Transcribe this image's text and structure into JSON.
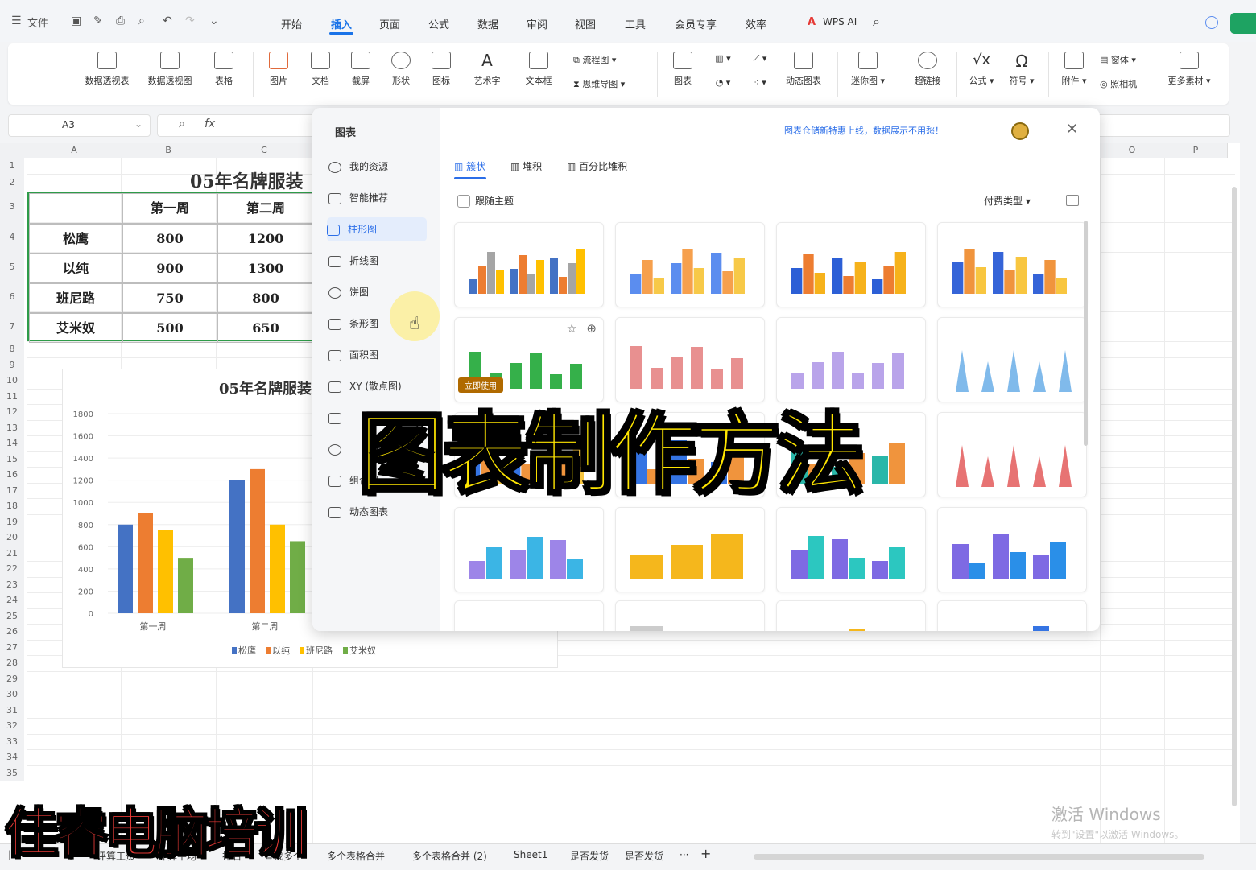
{
  "toolbar": {
    "file_label": "文件",
    "tabs": [
      "开始",
      "插入",
      "页面",
      "公式",
      "数据",
      "审阅",
      "视图",
      "工具",
      "会员专享",
      "效率"
    ],
    "active_tab": "插入",
    "wps_ai_label": "WPS AI"
  },
  "ribbon": {
    "items": [
      "数据透视表",
      "数据透视图",
      "表格",
      "图片",
      "文档",
      "截屏",
      "形状",
      "图标",
      "艺术字",
      "文本框",
      "流程图",
      "思维导图",
      "图表",
      "动态图表",
      "迷你图",
      "超链接",
      "公式",
      "符号",
      "附件",
      "窗体",
      "照相机",
      "更多素材"
    ]
  },
  "formula_bar": {
    "name_box": "A3",
    "fx_label": "fx"
  },
  "sheet": {
    "columns": [
      "A",
      "B",
      "C"
    ],
    "right_columns": [
      "O",
      "P"
    ],
    "rows": [
      "1",
      "2",
      "3",
      "4",
      "5",
      "6",
      "7",
      "8",
      "9",
      "10",
      "11",
      "12",
      "13",
      "14",
      "15",
      "16",
      "17",
      "18",
      "19",
      "20",
      "21",
      "22",
      "23",
      "24",
      "25",
      "26",
      "27",
      "28",
      "29",
      "30",
      "31",
      "32",
      "33",
      "34",
      "35"
    ],
    "title": "05年名牌服装",
    "header": [
      "",
      "第一周",
      "第二周"
    ],
    "table": [
      [
        "松鹰",
        "800",
        "1200"
      ],
      [
        "以纯",
        "900",
        "1300"
      ],
      [
        "班尼路",
        "750",
        "800"
      ],
      [
        "艾米奴",
        "500",
        "650"
      ]
    ]
  },
  "chart_data": {
    "type": "bar",
    "title": "05年名牌服装",
    "categories": [
      "第一周",
      "第二周"
    ],
    "series": [
      {
        "name": "松鹰",
        "values": [
          800,
          1200
        ]
      },
      {
        "name": "以纯",
        "values": [
          900,
          1300
        ]
      },
      {
        "name": "班尼路",
        "values": [
          750,
          800
        ]
      },
      {
        "name": "艾米奴",
        "values": [
          500,
          650
        ]
      }
    ],
    "colors": [
      "#4472c4",
      "#ed7d31",
      "#ffc000",
      "#70ad47"
    ],
    "yticks": [
      "1800",
      "1600",
      "1400",
      "1200",
      "1000",
      "800",
      "600",
      "400",
      "200",
      "0"
    ],
    "ylim": [
      0,
      1800
    ],
    "legend": "bottom"
  },
  "dialog": {
    "title": "图表",
    "nav": [
      "我的资源",
      "智能推荐",
      "柱形图",
      "折线图",
      "饼图",
      "条形图",
      "面积图",
      "XY (散点图)",
      "",
      "",
      "组合图",
      "动态图表"
    ],
    "active_nav": "柱形图",
    "notice": "图表仓储新特惠上线，数据展示不用愁！",
    "subtabs": [
      "簇状",
      "堆积",
      "百分比堆积"
    ],
    "checkbox_label": "跟随主题",
    "sort_label": "付费类型",
    "apply_label": "立即使用"
  },
  "sheet_tabs": [
    "评算工资",
    "评算平均",
    "排名",
    "查找多个",
    "多个表格合并",
    "多个表格合并 (2)",
    "Sheet1",
    "是否发货",
    "是否发货"
  ],
  "overlay": {
    "title": "图表制作方法",
    "brand": "佳睿电脑培训"
  },
  "watermark": {
    "line1": "激活 Windows",
    "line2": "转到\"设置\"以激活 Windows。"
  }
}
